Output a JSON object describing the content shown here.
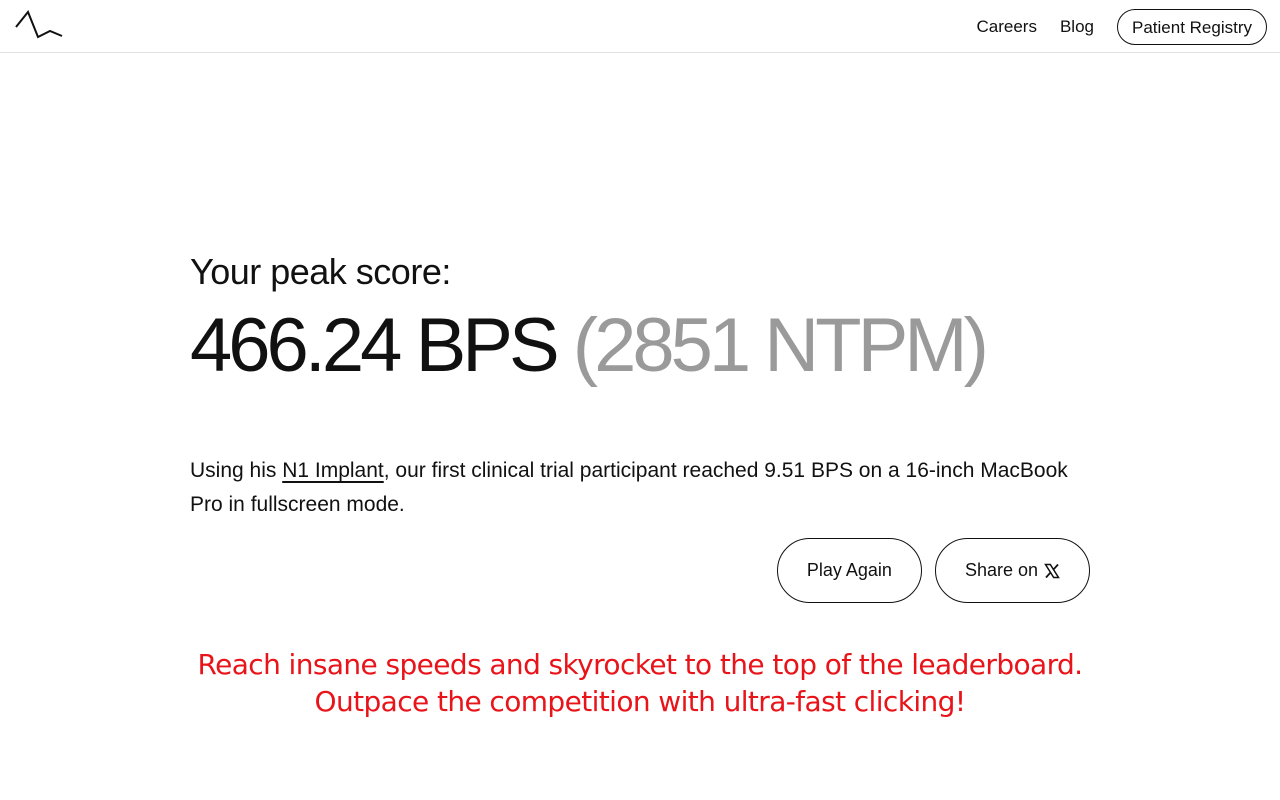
{
  "header": {
    "logo_icon": "neuralink-wave-icon",
    "nav": {
      "careers": "Careers",
      "blog": "Blog",
      "patient_registry": "Patient Registry"
    }
  },
  "result": {
    "label": "Your peak score:",
    "bps": "466.24 BPS",
    "ntpm": "(2851 NTPM)",
    "description_before": "Using his ",
    "implant_link": "N1 Implant",
    "description_after": ", our first clinical trial participant reached 9.51 BPS on a 16-inch MacBook Pro in fullscreen mode."
  },
  "actions": {
    "play_again": "Play Again",
    "share": "Share on",
    "share_icon": "x-logo-icon"
  },
  "promo": {
    "line1": "Reach insane speeds and skyrocket to the top of the leaderboard.",
    "line2": "Outpace the competition with ultra-fast clicking!",
    "color": "#e8141a"
  }
}
